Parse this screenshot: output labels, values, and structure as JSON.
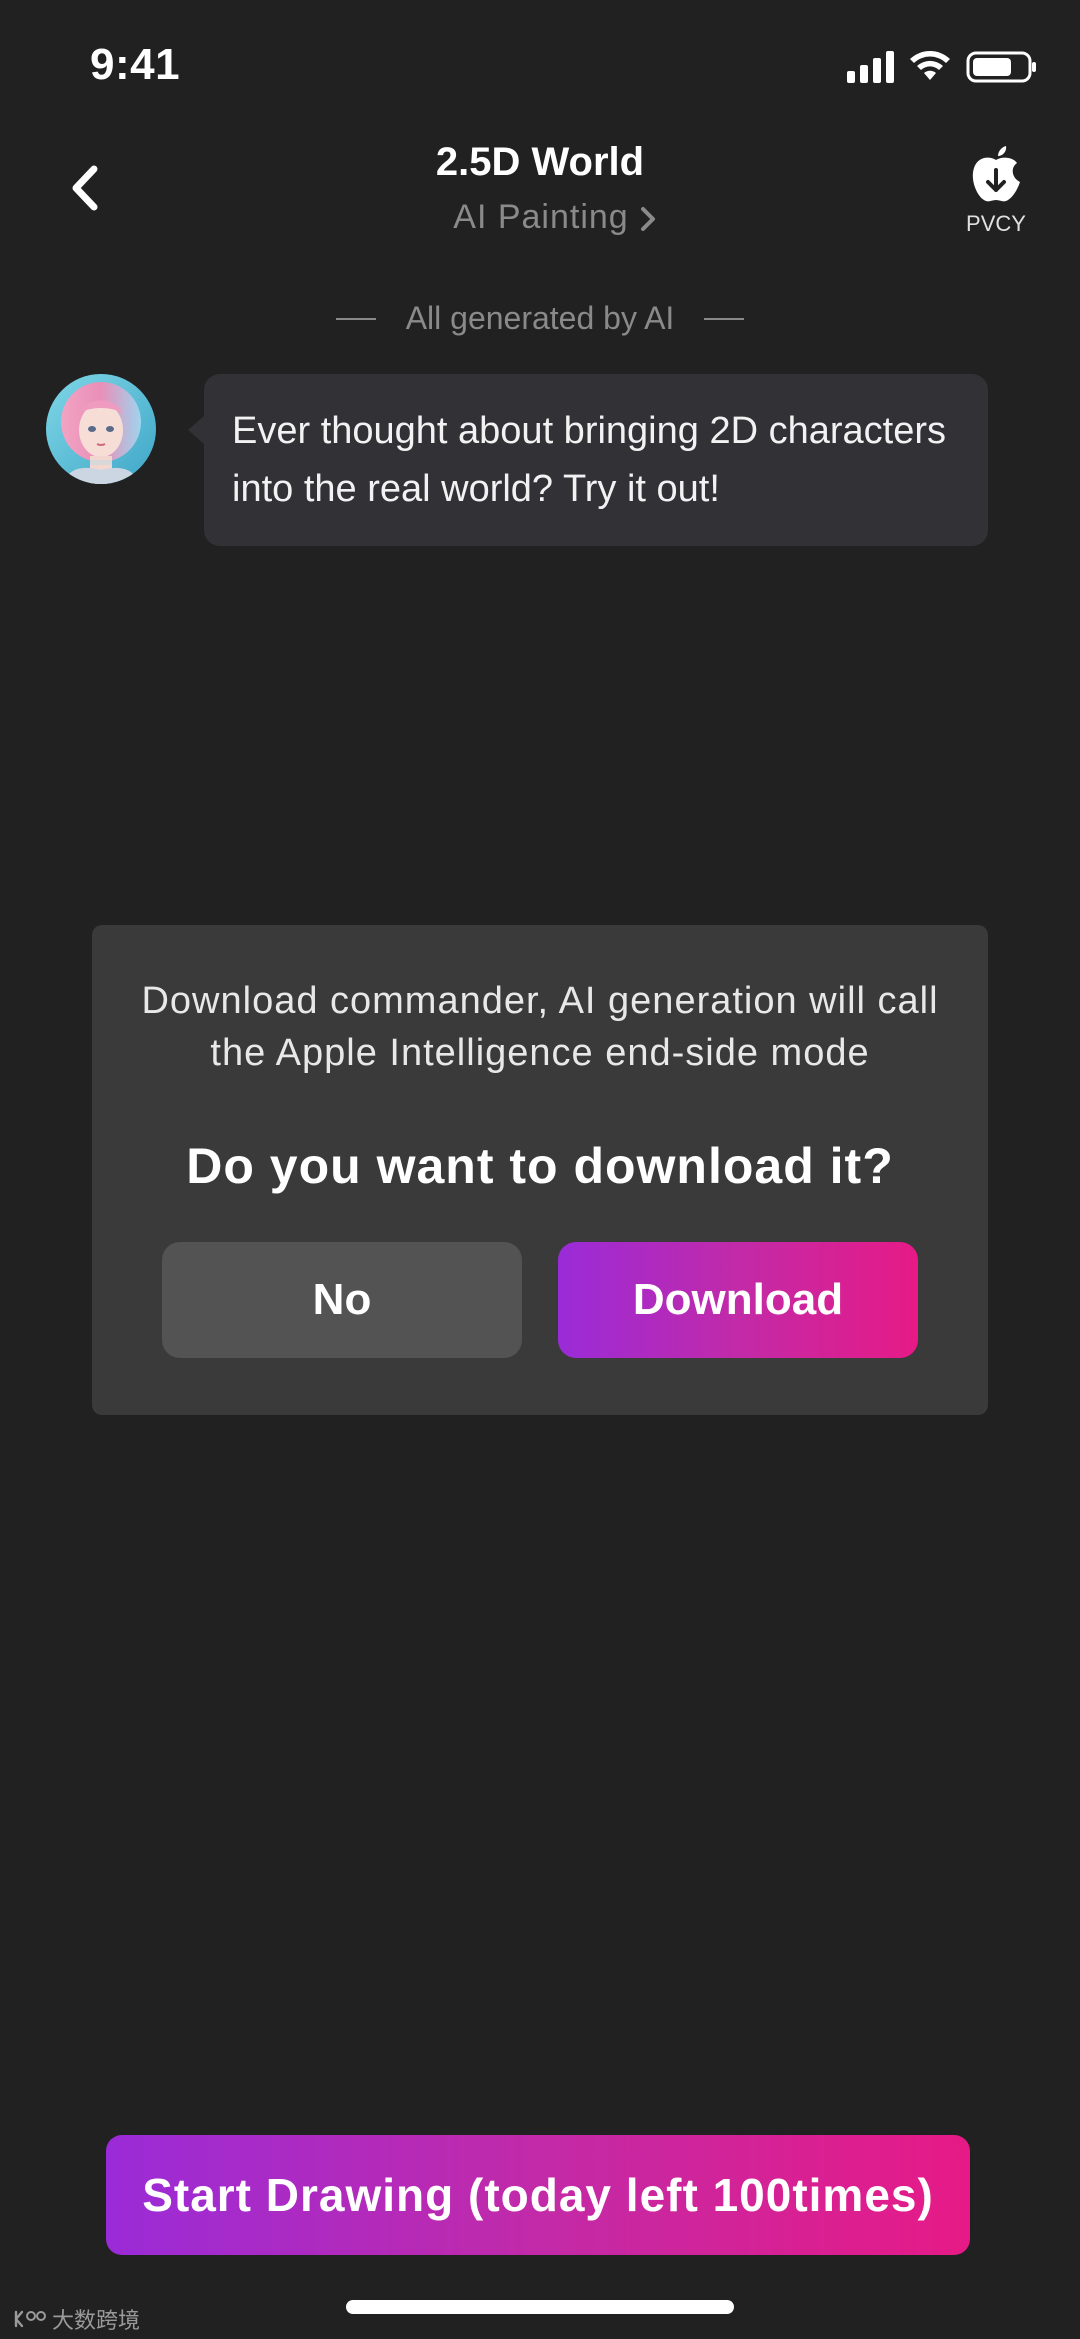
{
  "status_bar": {
    "time": "9:41"
  },
  "header": {
    "title": "2.5D World",
    "subtitle": "AI Painting",
    "brand_label": "PVCY"
  },
  "chat": {
    "generated_label": "All generated by AI",
    "message": "Ever thought about bringing 2D characters into the real world? Try it out!"
  },
  "dialog": {
    "message": "Download commander, AI generation will call the Apple Intelligence end-side mode",
    "question": "Do you want to download it?",
    "no_label": "No",
    "download_label": "Download"
  },
  "action": {
    "start_label": "Start Drawing (today left 100times)"
  },
  "watermark": {
    "text": "大数跨境"
  },
  "colors": {
    "background": "#212121",
    "bubble": "#323236",
    "dialog": "#3a3a3a",
    "no_button": "#535353",
    "gradient_start": "#9a2bd8",
    "gradient_end": "#e61a86"
  },
  "icons": {
    "back": "chevron-left-icon",
    "subtitle_arrow": "chevron-right-icon",
    "brand": "apple-download-icon",
    "signal": "cellular-signal-icon",
    "wifi": "wifi-icon",
    "battery": "battery-icon"
  }
}
